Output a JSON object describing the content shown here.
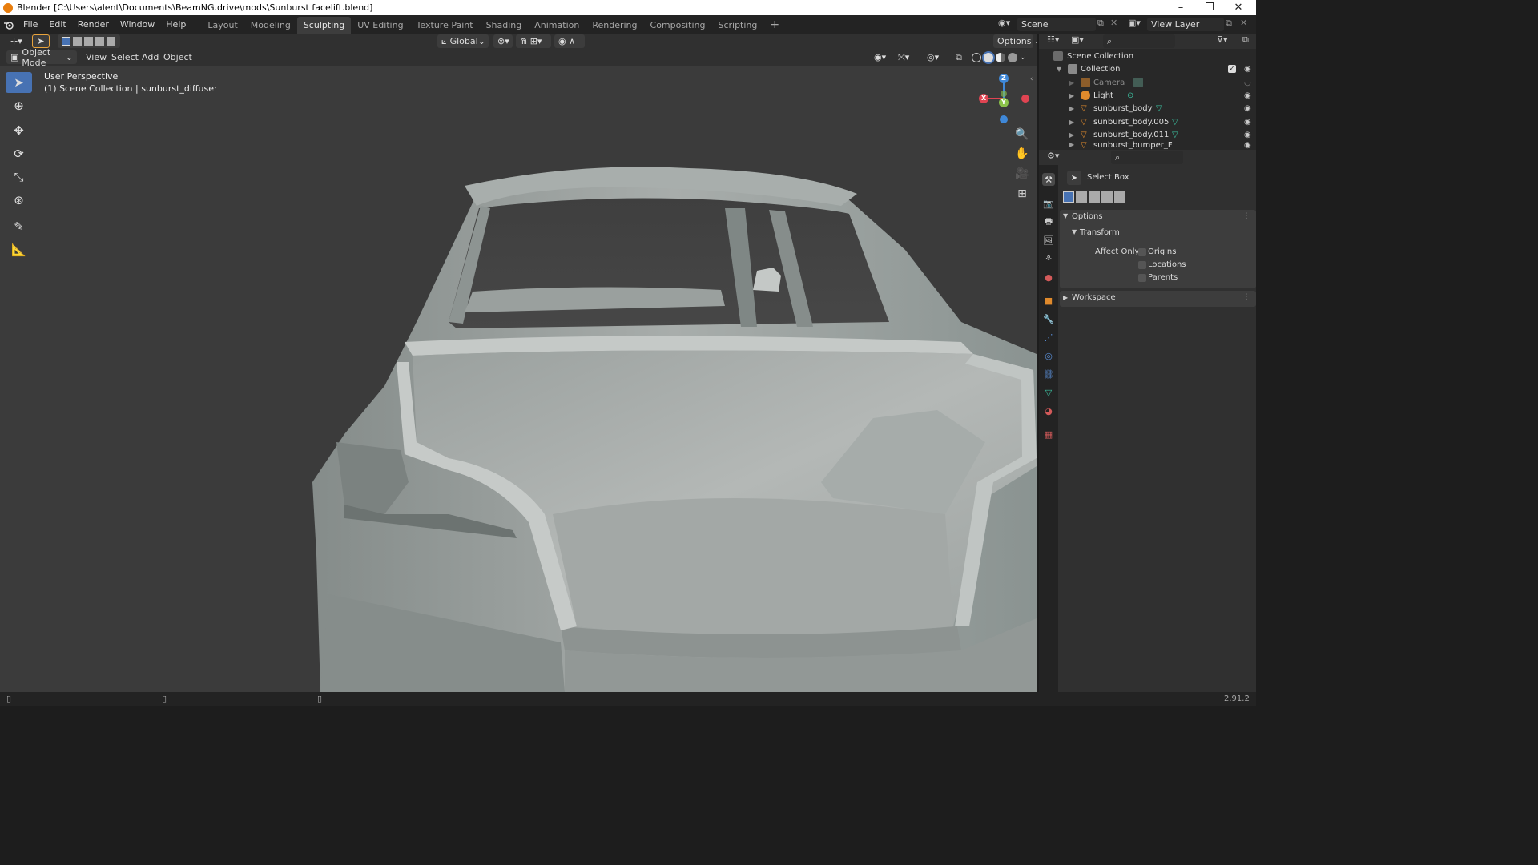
{
  "window": {
    "title": "Blender [C:\\Users\\alent\\Documents\\BeamNG.drive\\mods\\Sunburst facelift.blend]",
    "minimize": "–",
    "restore": "❐",
    "close": "✕"
  },
  "menu": {
    "file": "File",
    "edit": "Edit",
    "render": "Render",
    "window": "Window",
    "help": "Help"
  },
  "workspaces": [
    "Layout",
    "Modeling",
    "Sculpting",
    "UV Editing",
    "Texture Paint",
    "Shading",
    "Animation",
    "Rendering",
    "Compositing",
    "Scripting"
  ],
  "active_workspace": "Sculpting",
  "add_workspace": "+",
  "scene": {
    "name": "Scene",
    "view_layer": "View Layer"
  },
  "header": {
    "transform_orientation": "Global",
    "options": "Options"
  },
  "viewport_header": {
    "mode": "Object Mode",
    "view": "View",
    "select": "Select",
    "add": "Add",
    "object": "Object"
  },
  "viewport": {
    "perspective": "User Perspective",
    "context": "(1) Scene Collection | sunburst_diffuser"
  },
  "gizmo": {
    "x": "X",
    "y": "Y",
    "z": "Z"
  },
  "outliner": {
    "root": "Scene Collection",
    "collection": "Collection",
    "items": [
      {
        "name": "Camera",
        "type": "camera"
      },
      {
        "name": "Light",
        "type": "light"
      },
      {
        "name": "sunburst_body",
        "type": "mesh"
      },
      {
        "name": "sunburst_body.005",
        "type": "mesh"
      },
      {
        "name": "sunburst_body.011",
        "type": "mesh"
      },
      {
        "name": "sunburst_bumper_F",
        "type": "mesh"
      }
    ]
  },
  "properties": {
    "tool_name": "Select Box",
    "options_label": "Options",
    "transform_label": "Transform",
    "affect_only_label": "Affect Only",
    "checkboxes": [
      {
        "label": "Origins",
        "checked": false
      },
      {
        "label": "Locations",
        "checked": false
      },
      {
        "label": "Parents",
        "checked": false
      }
    ],
    "workspace_label": "Workspace"
  },
  "status": {
    "version": "2.91.2"
  },
  "colors": {
    "accent": "#4772b3",
    "mesh_icon": "#e08a2c",
    "axis_x": "#e04452",
    "axis_y": "#8bc34a",
    "axis_z": "#3f88d8"
  }
}
